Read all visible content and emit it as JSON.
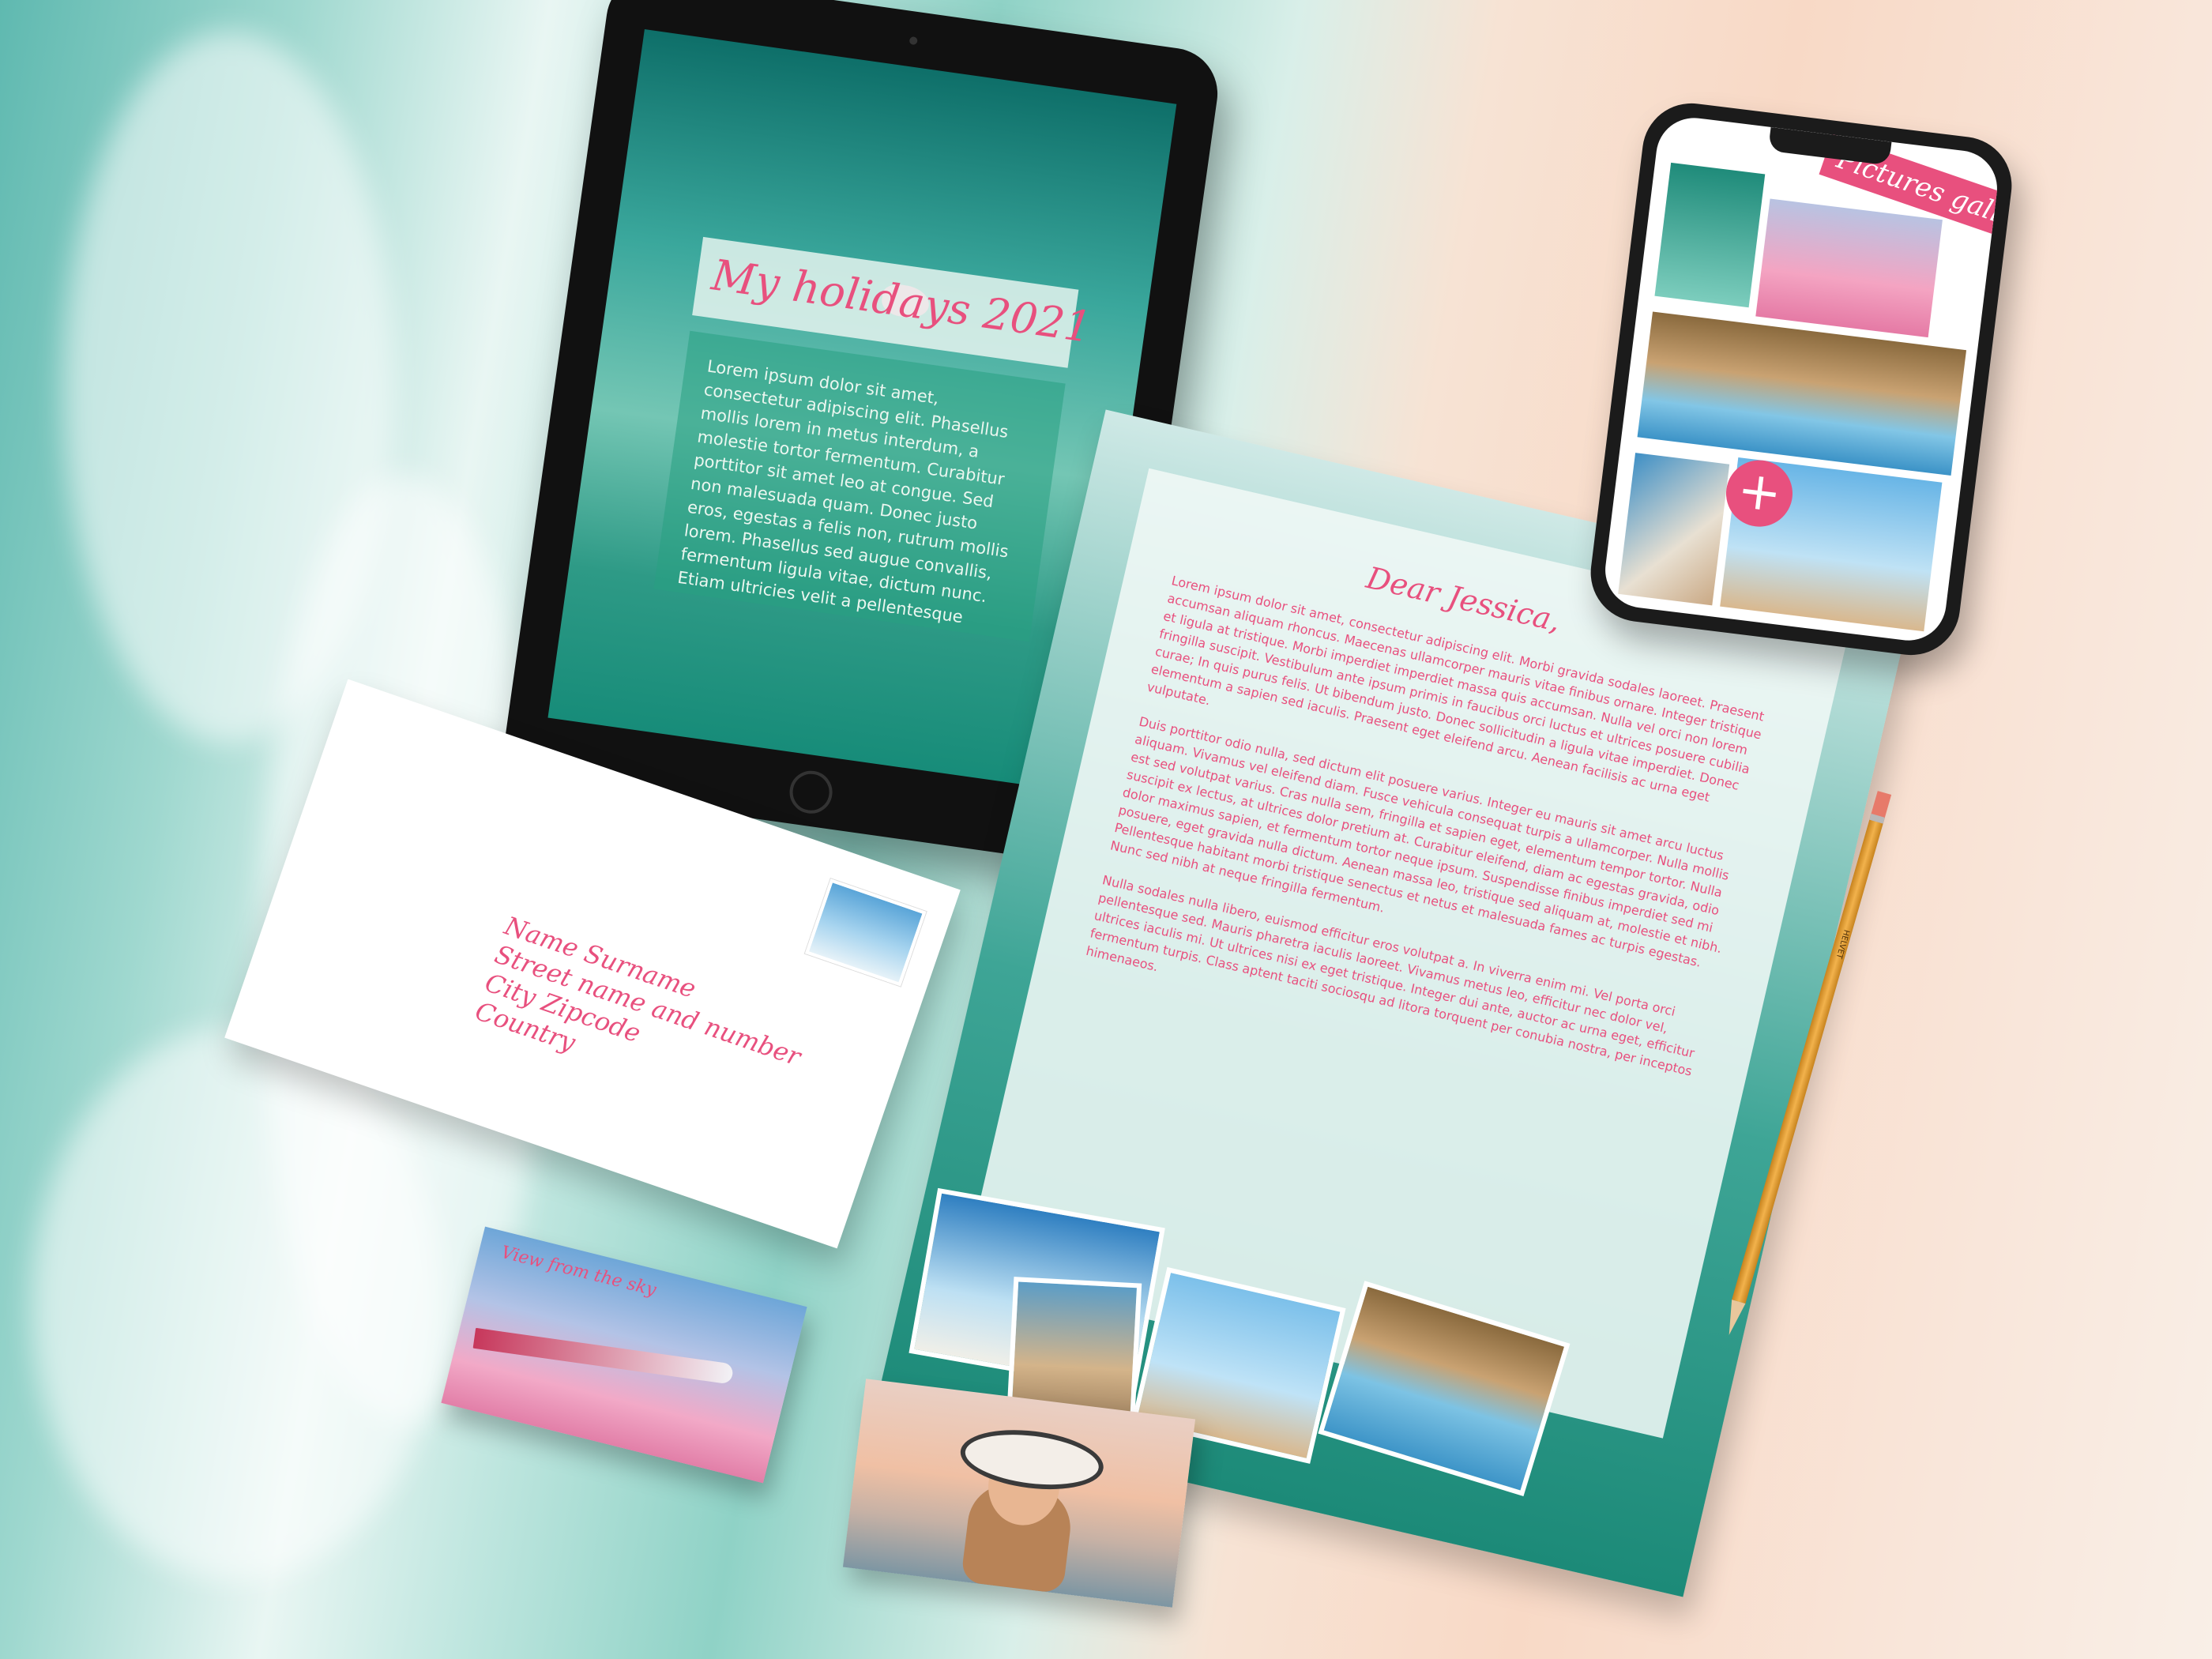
{
  "tablet": {
    "title": "My holidays 2021",
    "body": "Lorem ipsum dolor sit amet, consectetur adipiscing elit. Phasellus mollis lorem in metus interdum, a molestie tortor fermentum. Curabitur porttitor sit amet leo at congue. Sed non malesuada quam. Donec justo eros, egestas a felis non, rutrum mollis lorem. Phasellus sed augue convallis, fermentum ligula vitae, dictum nunc. Etiam ultricies velit a pellentesque"
  },
  "phone": {
    "gallery_title": "Pictures gallery",
    "add_icon": "plus-icon",
    "add_label": "+"
  },
  "letter": {
    "greeting": "Dear Jessica,",
    "para1": "Lorem ipsum dolor sit amet, consectetur adipiscing elit. Morbi gravida sodales laoreet. Praesent accumsan aliquam rhoncus. Maecenas ullamcorper mauris vitae finibus ornare. Integer tristique et ligula at tristique. Morbi imperdiet imperdiet massa quis accumsan. Nulla vel orci non lorem fringilla suscipit. Vestibulum ante ipsum primis in faucibus orci luctus et ultrices posuere cubilia curae; In quis purus felis. Ut bibendum justo. Donec sollicitudin a ligula vitae imperdiet. Donec elementum a sapien sed iaculis. Praesent eget eleifend arcu. Aenean facilisis ac urna eget vulputate.",
    "para2": "Duis porttitor odio nulla, sed dictum elit posuere varius. Integer eu mauris sit amet arcu luctus aliquam. Vivamus vel eleifend diam. Fusce vehicula consequat turpis a ullamcorper. Nulla mollis est sed volutpat varius. Cras nulla sem, fringilla et sapien eget, elementum tempor tortor. Nulla suscipit ex lectus, at ultrices dolor pretium at. Curabitur eleifend, diam ac egestas gravida, odio dolor maximus sapien, et fermentum tortor neque ipsum. Suspendisse finibus imperdiet sed mi posuere, eget gravida nulla dictum. Aenean massa leo, tristique sed aliquam at, molestie et nibh. Pellentesque habitant morbi tristique senectus et netus et malesuada fames ac turpis egestas. Nunc sed nibh at neque fringilla fermentum.",
    "para3": "Nulla sodales nulla libero, euismod efficitur eros volutpat a. In viverra enim mi. Vel porta orci pellentesque sed. Mauris pharetra iaculis laoreet. Vivamus metus leo, efficitur nec dolor vel, ultrices iaculis mi. Ut ultrices nisi ex eget tristique. Integer dui ante, auctor ac urna eget, efficitur fermentum turpis. Class aptent taciti sociosqu ad litora torquent per conubia nostra, per inceptos himenaeos."
  },
  "envelope": {
    "line1": "Name Surname",
    "line2": "Street name and number",
    "line3": "City Zipcode",
    "line4": "Country"
  },
  "card_sky": {
    "caption": "View from the sky"
  },
  "pencil": {
    "brand": "HELVET"
  }
}
